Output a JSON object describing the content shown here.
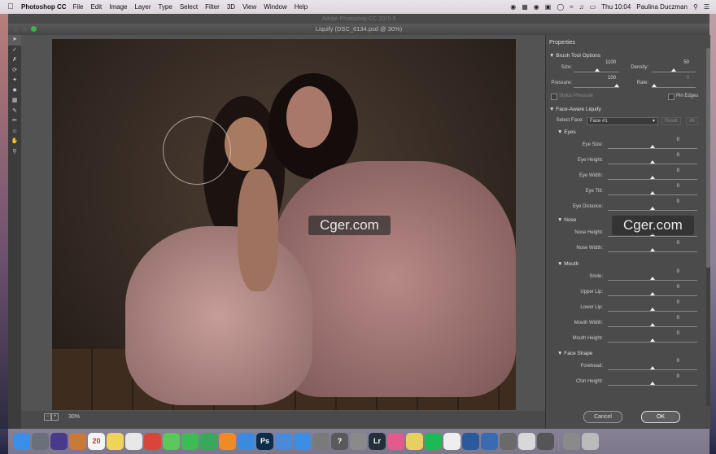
{
  "menubar": {
    "apple": "",
    "app": "Photoshop CC",
    "items": [
      "File",
      "Edit",
      "Image",
      "Layer",
      "Type",
      "Select",
      "Filter",
      "3D",
      "View",
      "Window",
      "Help"
    ],
    "clock": "Thu 10:04",
    "user": "Paulina Duczman"
  },
  "behind_title": "Adobe Photoshop CC 2015.5",
  "window": {
    "title": "Liquify (DSC_6134.psd @ 30%)"
  },
  "statusbar": {
    "zoom": "30%"
  },
  "watermarks": [
    "Cger.com",
    "Cger.com"
  ],
  "properties": {
    "title": "Properties",
    "brush": {
      "header": "Brush Tool Options",
      "size_label": "Size:",
      "size": "1100",
      "density_label": "Density:",
      "density": "50",
      "pressure_label": "Pressure:",
      "pressure": "100",
      "rate_label": "Rate:",
      "rate": "0",
      "stylus": "Stylus Pressure",
      "pin": "Pin Edges"
    },
    "face": {
      "header": "Face-Aware Liquify",
      "select_label": "Select Face:",
      "select_value": "Face #1",
      "reset": "Reset",
      "all": "All",
      "eyes": {
        "header": "Eyes",
        "rows": [
          {
            "label": "Eye Size:",
            "value": "0"
          },
          {
            "label": "Eye Height:",
            "value": "0"
          },
          {
            "label": "Eye Width:",
            "value": "0"
          },
          {
            "label": "Eye Tilt:",
            "value": "0"
          },
          {
            "label": "Eye Distance:",
            "value": "0"
          }
        ]
      },
      "nose": {
        "header": "Nose",
        "rows": [
          {
            "label": "Nose Height:",
            "value": "0"
          },
          {
            "label": "Nose Width:",
            "value": "0"
          }
        ]
      },
      "mouth": {
        "header": "Mouth",
        "rows": [
          {
            "label": "Smile:",
            "value": "0"
          },
          {
            "label": "Upper Lip:",
            "value": "0"
          },
          {
            "label": "Lower Lip:",
            "value": "0"
          },
          {
            "label": "Mouth Width:",
            "value": "0"
          },
          {
            "label": "Mouth Height:",
            "value": "0"
          }
        ]
      },
      "shape": {
        "header": "Face Shape",
        "rows": [
          {
            "label": "Forehead:",
            "value": "0"
          },
          {
            "label": "Chin Height:",
            "value": "0"
          }
        ]
      }
    },
    "cancel": "Cancel",
    "ok": "OK"
  },
  "dock": {
    "items": [
      {
        "name": "finder-icon",
        "color": "#3b8fe8",
        "glyph": ""
      },
      {
        "name": "launchpad-icon",
        "color": "#6b6f7a",
        "glyph": ""
      },
      {
        "name": "siri-icon",
        "color": "#4a3a8c",
        "glyph": ""
      },
      {
        "name": "photos-icon",
        "color": "#c97a3a",
        "glyph": ""
      },
      {
        "name": "calendar-icon",
        "color": "#f4f4f4",
        "glyph": "20"
      },
      {
        "name": "notes-icon",
        "color": "#f0d35a",
        "glyph": ""
      },
      {
        "name": "reminders-icon",
        "color": "#e8e8e8",
        "glyph": ""
      },
      {
        "name": "chrome-icon",
        "color": "#d9453b",
        "glyph": ""
      },
      {
        "name": "messages-icon",
        "color": "#5ac85a",
        "glyph": ""
      },
      {
        "name": "facetime-icon",
        "color": "#3dbb54",
        "glyph": ""
      },
      {
        "name": "numbers-icon",
        "color": "#3aa85c",
        "glyph": ""
      },
      {
        "name": "ibooks-icon",
        "color": "#f08a24",
        "glyph": ""
      },
      {
        "name": "safari-icon",
        "color": "#3a8be0",
        "glyph": ""
      },
      {
        "name": "photoshop-icon",
        "color": "#0d2b4a",
        "glyph": "Ps"
      },
      {
        "name": "preview-icon",
        "color": "#4a8ad8",
        "glyph": ""
      },
      {
        "name": "appstore-icon",
        "color": "#3a8fe4",
        "glyph": ""
      },
      {
        "name": "system-preferences-icon",
        "color": "#7a7a7a",
        "glyph": ""
      },
      {
        "name": "help-icon",
        "color": "#5a5a5a",
        "glyph": "?"
      },
      {
        "name": "script-icon",
        "color": "#8a8a8a",
        "glyph": ""
      },
      {
        "name": "lightroom-icon",
        "color": "#22303a",
        "glyph": "Lr"
      },
      {
        "name": "itunes-icon",
        "color": "#e35a8c",
        "glyph": ""
      },
      {
        "name": "stickies-icon",
        "color": "#e8d060",
        "glyph": ""
      },
      {
        "name": "spotify-icon",
        "color": "#1db954",
        "glyph": ""
      },
      {
        "name": "undo-app-icon",
        "color": "#eeeeee",
        "glyph": ""
      },
      {
        "name": "quicktime-icon",
        "color": "#2a5a9a",
        "glyph": ""
      },
      {
        "name": "network-icon",
        "color": "#3a6ab0",
        "glyph": ""
      },
      {
        "name": "image-capture-icon",
        "color": "#6a6a6a",
        "glyph": ""
      },
      {
        "name": "window-icon",
        "color": "#d8d8d8",
        "glyph": ""
      },
      {
        "name": "keyboard-icon",
        "color": "#555555",
        "glyph": ""
      },
      {
        "name": "folder-icon",
        "color": "#8a8a8a",
        "glyph": ""
      },
      {
        "name": "trash-icon",
        "color": "#bbbbbb",
        "glyph": ""
      }
    ]
  }
}
